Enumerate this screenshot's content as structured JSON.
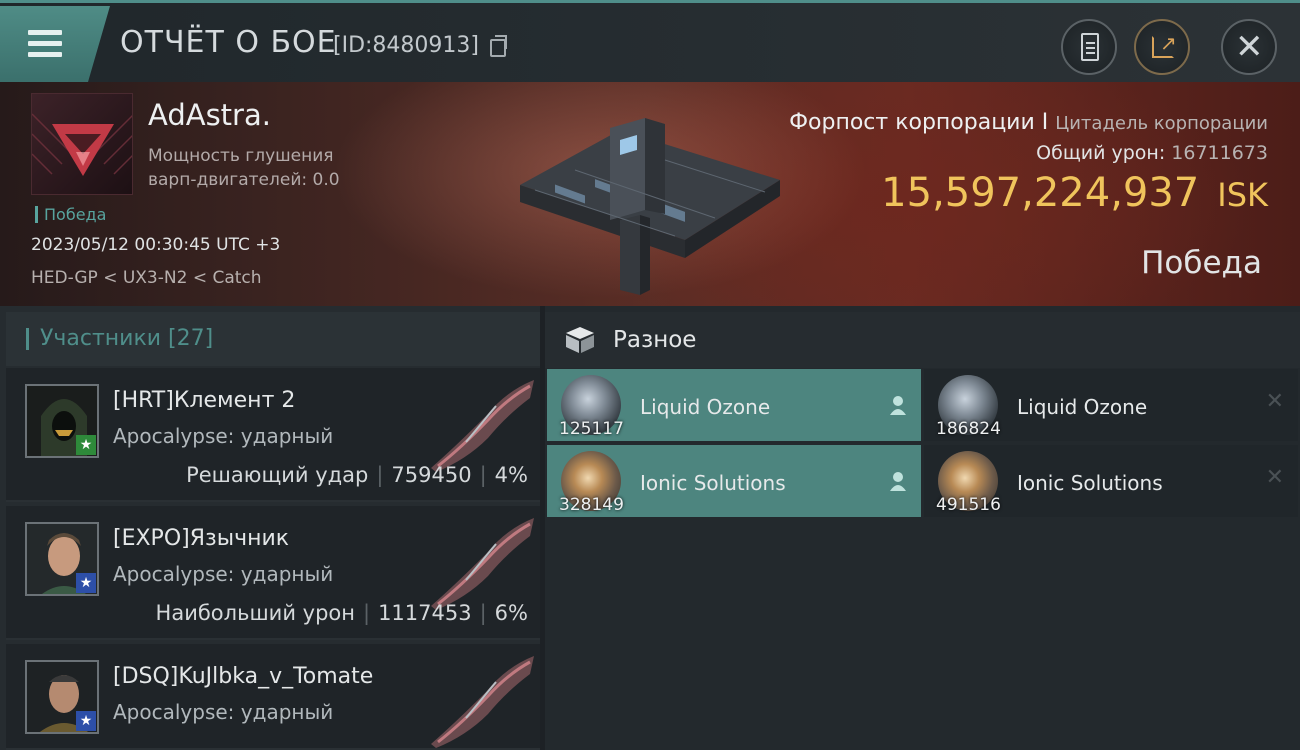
{
  "header": {
    "title": "ОТЧЁТ О БОЕ",
    "report_id": "[ID:8480913]",
    "icons": [
      "menu-icon",
      "copy-icon",
      "clipboard-icon",
      "share-icon",
      "close-icon"
    ]
  },
  "victim": {
    "name": "AdAstra.",
    "scram_line1": "Мощность глушения",
    "scram_line2": "варп-двигателей: 0.0",
    "tag": "Победа",
    "datetime": "2023/05/12 00:30:45 UTC +3",
    "route": "HED-GP < UX3-N2 < Catch",
    "structure_name": "Форпост корпорации I",
    "structure_class": "Цитадель корпорации",
    "total_damage_label": "Общий урон:",
    "total_damage_value": "16711673",
    "isk_value": "15,597,224,937",
    "isk_unit": "ISK",
    "result": "Победа"
  },
  "participants": {
    "label": "Участники [27]",
    "items": [
      {
        "name": "[HRT]Клемент 2",
        "ship": "Apocalypse: ударный",
        "stat_label": "Решающий удар",
        "damage": "759450",
        "percent": "4%",
        "badge_color": "#2e8a3a",
        "badge": "★"
      },
      {
        "name": "[EXPO]Язычник",
        "ship": "Apocalypse: ударный",
        "stat_label": "Наибольший урон",
        "damage": "1117453",
        "percent": "6%",
        "badge_color": "#2d4fa8",
        "badge": "★"
      },
      {
        "name": "[DSQ]KuJlbka_v_Tomate",
        "ship": "Apocalypse: ударный",
        "stat_label": "",
        "damage": "",
        "percent": "",
        "badge_color": "#2d4fa8",
        "badge": "★"
      }
    ]
  },
  "misc": {
    "label": "Разное",
    "items": [
      {
        "name": "Liquid Ozone",
        "qty": "125117",
        "state": "dropped"
      },
      {
        "name": "Liquid Ozone",
        "qty": "186824",
        "state": "destroyed"
      },
      {
        "name": "Ionic Solutions",
        "qty": "328149",
        "state": "dropped"
      },
      {
        "name": "Ionic Solutions",
        "qty": "491516",
        "state": "destroyed"
      }
    ],
    "destroyed_mark": "✕"
  },
  "colors": {
    "accent": "#4f8e8a",
    "isk": "#f0c45c",
    "selected_item": "#4d857f"
  }
}
